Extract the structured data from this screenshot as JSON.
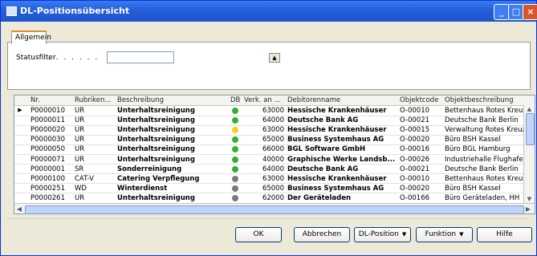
{
  "window": {
    "title": "DL-Positionsübersicht"
  },
  "tabs": [
    {
      "label": "Allgemein"
    }
  ],
  "filter": {
    "label": "Statusfilter",
    "dots": ". . . . . . .",
    "value": ""
  },
  "table": {
    "columns": [
      "Nr.",
      "Rubriken...",
      "Beschreibung",
      "DB",
      "Verk. an ...",
      "Debitorenname",
      "Objektcode",
      "Objektbeschreibung"
    ],
    "rows": [
      {
        "nr": "P0000010",
        "rubrik": "UR",
        "beschreibung": "Unterhaltsreinigung",
        "db": "#33b033",
        "verk": "63000",
        "debitor": "Hessische Krankenhäuser",
        "objektcode": "O-00010",
        "objekt": "Bettenhaus Rotes Kreuz"
      },
      {
        "nr": "P0000011",
        "rubrik": "UR",
        "beschreibung": "Unterhaltsreinigung",
        "db": "#33b033",
        "verk": "64000",
        "debitor": "Deutsche Bank AG",
        "objektcode": "O-00021",
        "objekt": "Deutsche Bank Berlin"
      },
      {
        "nr": "P0000020",
        "rubrik": "UR",
        "beschreibung": "Unterhaltsreinigung",
        "db": "#f2d21b",
        "verk": "63000",
        "debitor": "Hessische Krankenhäuser",
        "objektcode": "O-00015",
        "objekt": "Verwaltung Rotes Kreuz"
      },
      {
        "nr": "P0000030",
        "rubrik": "UR",
        "beschreibung": "Unterhaltsreinigung",
        "db": "#33b033",
        "verk": "65000",
        "debitor": "Business Systemhaus AG",
        "objektcode": "O-00020",
        "objekt": "Büro BSH Kassel"
      },
      {
        "nr": "P0000050",
        "rubrik": "UR",
        "beschreibung": "Unterhaltsreinigung",
        "db": "#33b033",
        "verk": "66000",
        "debitor": "BGL Software GmbH",
        "objektcode": "O-00016",
        "objekt": "Büro BGL Hamburg"
      },
      {
        "nr": "P0000071",
        "rubrik": "UR",
        "beschreibung": "Unterhaltsreinigung",
        "db": "#33b033",
        "verk": "40000",
        "debitor": "Graphische Werke Landsb...",
        "objektcode": "O-00026",
        "objekt": "Industriehalle Flughafen"
      },
      {
        "nr": "P0000001",
        "rubrik": "SR",
        "beschreibung": "Sonderreinigung",
        "db": "#33b033",
        "verk": "64000",
        "debitor": "Deutsche Bank AG",
        "objektcode": "O-00021",
        "objekt": "Deutsche Bank Berlin"
      },
      {
        "nr": "P0000100",
        "rubrik": "CAT-V",
        "beschreibung": "Catering Verpflegung",
        "db": "#7a7a7a",
        "verk": "63000",
        "debitor": "Hessische Krankenhäuser",
        "objektcode": "O-00010",
        "objekt": "Bettenhaus Rotes Kreuz"
      },
      {
        "nr": "P0000251",
        "rubrik": "WD",
        "beschreibung": "Winterdienst",
        "db": "#7a7a7a",
        "verk": "65000",
        "debitor": "Business Systemhaus AG",
        "objektcode": "O-00020",
        "objekt": "Büro BSH Kassel"
      },
      {
        "nr": "P0000261",
        "rubrik": "UR",
        "beschreibung": "Unterhaltsreinigung",
        "db": "#7a7a7a",
        "verk": "62000",
        "debitor": "Der Geräteladen",
        "objektcode": "O-00166",
        "objekt": "Büro Geräteladen, HH"
      }
    ]
  },
  "buttons": {
    "ok": "OK",
    "cancel": "Abbrechen",
    "dl_position": "DL-Position",
    "funktion": "Funktion",
    "hilfe": "Hilfe"
  },
  "colors": {
    "titlebar": "#245edb",
    "selected_row_arrow": "#000000"
  }
}
